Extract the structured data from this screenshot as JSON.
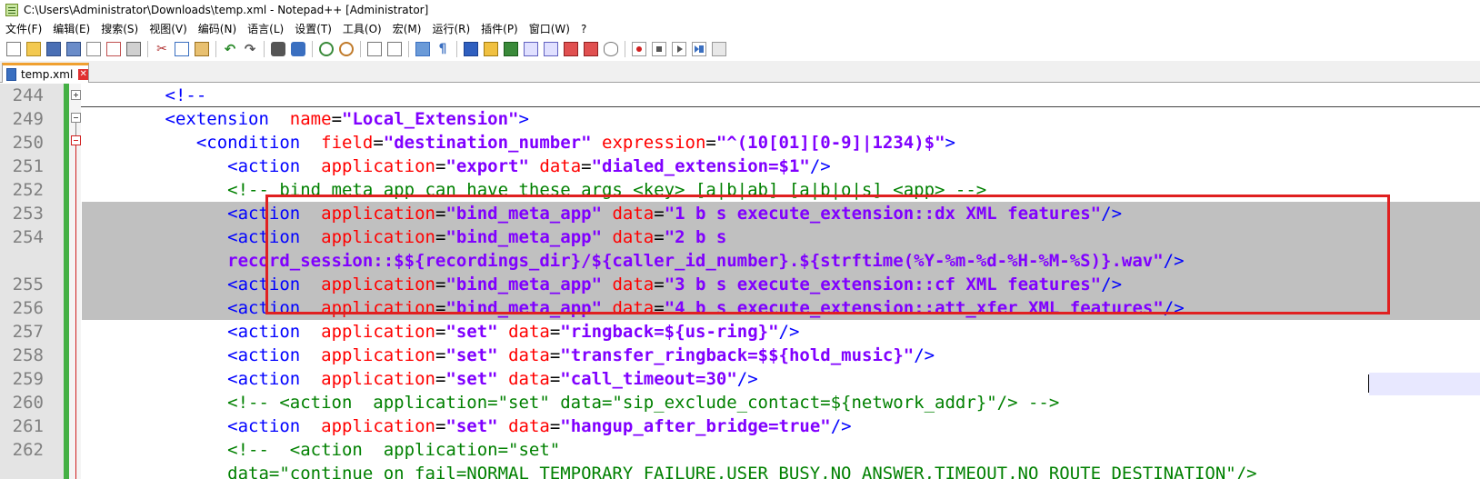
{
  "window": {
    "title": "C:\\Users\\Administrator\\Downloads\\temp.xml - Notepad++ [Administrator]"
  },
  "menu": [
    {
      "label": "文件(F)"
    },
    {
      "label": "编辑(E)"
    },
    {
      "label": "搜索(S)"
    },
    {
      "label": "视图(V)"
    },
    {
      "label": "编码(N)"
    },
    {
      "label": "语言(L)"
    },
    {
      "label": "设置(T)"
    },
    {
      "label": "工具(O)"
    },
    {
      "label": "宏(M)"
    },
    {
      "label": "运行(R)"
    },
    {
      "label": "插件(P)"
    },
    {
      "label": "窗口(W)"
    },
    {
      "label": "?"
    }
  ],
  "toolbar_icons": [
    "new-file-icon",
    "open-file-icon",
    "save-icon",
    "save-all-icon",
    "close-icon",
    "close-all-icon",
    "print-icon",
    "cut-icon",
    "copy-icon",
    "paste-icon",
    "undo-icon",
    "redo-icon",
    "find-icon",
    "replace-icon",
    "zoom-in-icon",
    "zoom-out-icon",
    "sync-scroll-icon",
    "word-wrap-icon",
    "show-all-chars-icon",
    "indent-guide-icon",
    "user-language-icon",
    "document-map-icon",
    "function-list-icon",
    "folder-workspace-icon",
    "monitoring-icon",
    "record-macro-icon",
    "stop-record-icon",
    "play-macro-icon",
    "run-macro-multiple-icon",
    "save-macro-icon"
  ],
  "tab": {
    "label": "temp.xml",
    "close_symbol": "✕"
  },
  "editor": {
    "line_numbers": [
      "244",
      "249",
      "250",
      "251",
      "252",
      "253",
      "254",
      "",
      "255",
      "256",
      "257",
      "258",
      "259",
      "260",
      "261",
      "262",
      ""
    ],
    "lines": [
      {
        "indent": "        ",
        "tokens": [
          [
            "t-tag",
            "<!--"
          ]
        ]
      },
      {
        "indent": "        ",
        "tokens": [
          [
            "t-tag",
            "<extension"
          ],
          [
            "t-plain",
            "  "
          ],
          [
            "t-attr",
            "name"
          ],
          [
            "t-eq",
            "="
          ],
          [
            "t-val",
            "\"Local_Extension\""
          ],
          [
            "t-tag",
            ">"
          ]
        ]
      },
      {
        "indent": "           ",
        "tokens": [
          [
            "t-tag",
            "<condition"
          ],
          [
            "t-plain",
            "  "
          ],
          [
            "t-attr",
            "field"
          ],
          [
            "t-eq",
            "="
          ],
          [
            "t-val",
            "\"destination_number\""
          ],
          [
            "t-plain",
            " "
          ],
          [
            "t-attr",
            "expression"
          ],
          [
            "t-eq",
            "="
          ],
          [
            "t-val",
            "\"^(10[01][0-9]|1234)$\""
          ],
          [
            "t-tag",
            ">"
          ]
        ]
      },
      {
        "indent": "              ",
        "tokens": [
          [
            "t-tag",
            "<action"
          ],
          [
            "t-plain",
            "  "
          ],
          [
            "t-attr",
            "application"
          ],
          [
            "t-eq",
            "="
          ],
          [
            "t-val",
            "\"export\""
          ],
          [
            "t-plain",
            " "
          ],
          [
            "t-attr",
            "data"
          ],
          [
            "t-eq",
            "="
          ],
          [
            "t-val",
            "\"dialed_extension=$1\""
          ],
          [
            "t-tag",
            "/>"
          ]
        ]
      },
      {
        "indent": "              ",
        "tokens": [
          [
            "t-comment",
            "<!-- bind meta app can have these args <key> [a|b|ab] [a|b|o|s] <app> -->"
          ]
        ]
      },
      {
        "indent": "              ",
        "sel": true,
        "tokens": [
          [
            "t-tag",
            "<action"
          ],
          [
            "t-plain",
            "  "
          ],
          [
            "t-attr",
            "application"
          ],
          [
            "t-eq",
            "="
          ],
          [
            "t-val",
            "\"bind_meta_app\""
          ],
          [
            "t-plain",
            " "
          ],
          [
            "t-attr",
            "data"
          ],
          [
            "t-eq",
            "="
          ],
          [
            "t-val",
            "\"1 b s execute_extension::dx XML features\""
          ],
          [
            "t-tag",
            "/>"
          ]
        ]
      },
      {
        "indent": "              ",
        "sel": true,
        "tokens": [
          [
            "t-tag",
            "<action"
          ],
          [
            "t-plain",
            "  "
          ],
          [
            "t-attr",
            "application"
          ],
          [
            "t-eq",
            "="
          ],
          [
            "t-val",
            "\"bind_meta_app\""
          ],
          [
            "t-plain",
            " "
          ],
          [
            "t-attr",
            "data"
          ],
          [
            "t-eq",
            "="
          ],
          [
            "t-val",
            "\"2 b s "
          ]
        ]
      },
      {
        "indent": "              ",
        "sel": true,
        "tokens": [
          [
            "t-val",
            "record_session::$${recordings_dir}/${caller_id_number}.${strftime(%Y-%m-%d-%H-%M-%S)}.wav\""
          ],
          [
            "t-tag",
            "/>"
          ]
        ]
      },
      {
        "indent": "              ",
        "sel": true,
        "tokens": [
          [
            "t-tag",
            "<action"
          ],
          [
            "t-plain",
            "  "
          ],
          [
            "t-attr",
            "application"
          ],
          [
            "t-eq",
            "="
          ],
          [
            "t-val",
            "\"bind_meta_app\""
          ],
          [
            "t-plain",
            " "
          ],
          [
            "t-attr",
            "data"
          ],
          [
            "t-eq",
            "="
          ],
          [
            "t-val",
            "\"3 b s execute_extension::cf XML features\""
          ],
          [
            "t-tag",
            "/>"
          ]
        ]
      },
      {
        "indent": "              ",
        "sel": true,
        "tokens": [
          [
            "t-tag",
            "<action"
          ],
          [
            "t-plain",
            "  "
          ],
          [
            "t-attr",
            "application"
          ],
          [
            "t-eq",
            "="
          ],
          [
            "t-val",
            "\"bind_meta_app\""
          ],
          [
            "t-plain",
            " "
          ],
          [
            "t-attr",
            "data"
          ],
          [
            "t-eq",
            "="
          ],
          [
            "t-val",
            "\"4 b s execute_extension::att_xfer XML features\""
          ],
          [
            "t-tag",
            "/>"
          ]
        ]
      },
      {
        "indent": "              ",
        "tokens": [
          [
            "t-tag",
            "<action"
          ],
          [
            "t-plain",
            "  "
          ],
          [
            "t-attr",
            "application"
          ],
          [
            "t-eq",
            "="
          ],
          [
            "t-val",
            "\"set\""
          ],
          [
            "t-plain",
            " "
          ],
          [
            "t-attr",
            "data"
          ],
          [
            "t-eq",
            "="
          ],
          [
            "t-val",
            "\"ringback=${us-ring}\""
          ],
          [
            "t-tag",
            "/>"
          ]
        ]
      },
      {
        "indent": "              ",
        "tokens": [
          [
            "t-tag",
            "<action"
          ],
          [
            "t-plain",
            "  "
          ],
          [
            "t-attr",
            "application"
          ],
          [
            "t-eq",
            "="
          ],
          [
            "t-val",
            "\"set\""
          ],
          [
            "t-plain",
            " "
          ],
          [
            "t-attr",
            "data"
          ],
          [
            "t-eq",
            "="
          ],
          [
            "t-val",
            "\"transfer_ringback=$${hold_music}\""
          ],
          [
            "t-tag",
            "/>"
          ]
        ]
      },
      {
        "indent": "              ",
        "tokens": [
          [
            "t-tag",
            "<action"
          ],
          [
            "t-plain",
            "  "
          ],
          [
            "t-attr",
            "application"
          ],
          [
            "t-eq",
            "="
          ],
          [
            "t-val",
            "\"set\""
          ],
          [
            "t-plain",
            " "
          ],
          [
            "t-attr",
            "data"
          ],
          [
            "t-eq",
            "="
          ],
          [
            "t-val",
            "\"call_timeout=30\""
          ],
          [
            "t-tag",
            "/>"
          ]
        ]
      },
      {
        "indent": "              ",
        "tokens": [
          [
            "t-comment",
            "<!-- <action  application=\"set\" data=\"sip_exclude_contact=${network_addr}\"/> -->"
          ]
        ]
      },
      {
        "indent": "              ",
        "tokens": [
          [
            "t-tag",
            "<action"
          ],
          [
            "t-plain",
            "  "
          ],
          [
            "t-attr",
            "application"
          ],
          [
            "t-eq",
            "="
          ],
          [
            "t-val",
            "\"set\""
          ],
          [
            "t-plain",
            " "
          ],
          [
            "t-attr",
            "data"
          ],
          [
            "t-eq",
            "="
          ],
          [
            "t-val",
            "\"hangup_after_bridge=true\""
          ],
          [
            "t-tag",
            "/>"
          ]
        ]
      },
      {
        "indent": "              ",
        "tokens": [
          [
            "t-comment",
            "<!--  <action  application=\"set\""
          ]
        ]
      },
      {
        "indent": "              ",
        "tokens": [
          [
            "t-comment",
            "data=\"continue_on_fail=NORMAL_TEMPORARY_FAILURE,USER_BUSY,NO_ANSWER,TIMEOUT,NO_ROUTE_DESTINATION\"/>"
          ]
        ]
      }
    ]
  }
}
